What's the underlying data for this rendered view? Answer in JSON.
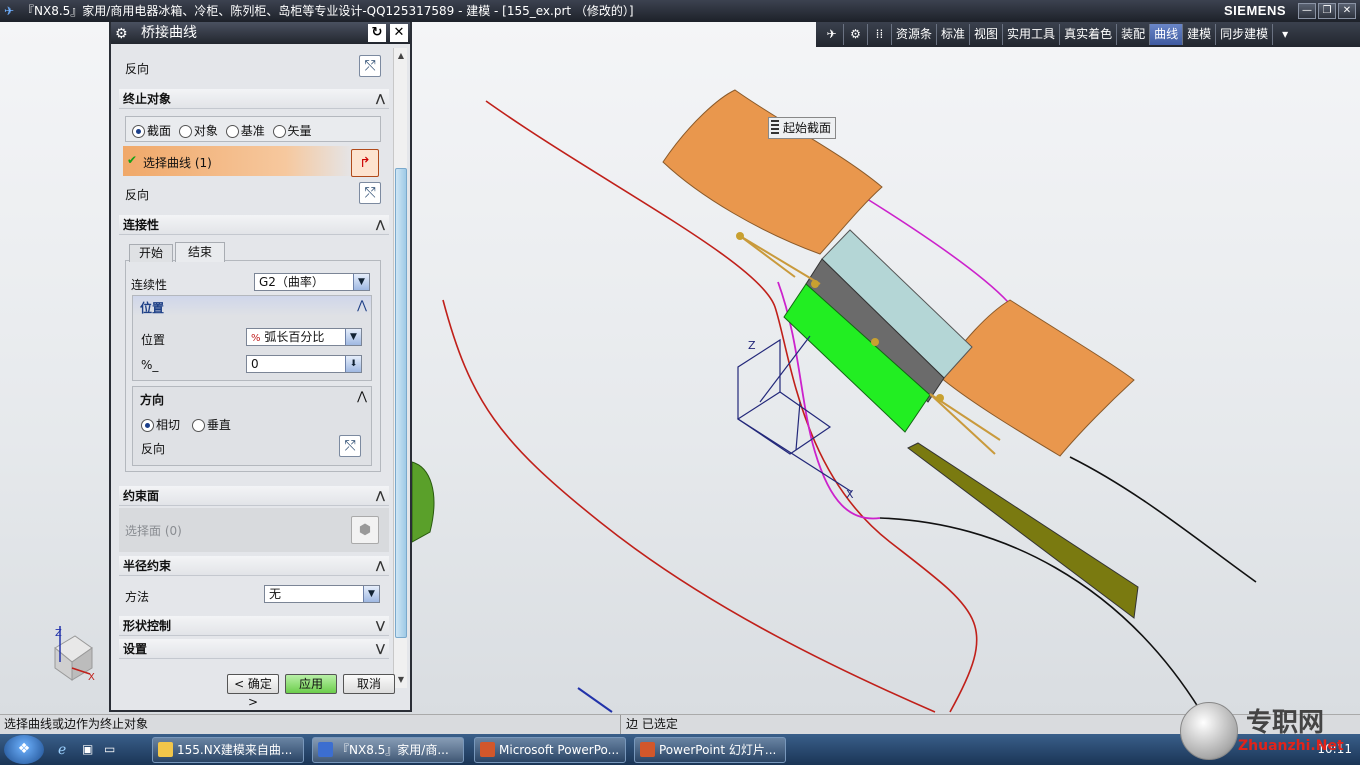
{
  "window": {
    "title": "『NX8.5』家用/商用电器冰箱、冷柜、陈列柜、岛柜等专业设计-QQ125317589 - 建模 - [155_ex.prt （修改的）]",
    "brand": "SIEMENS",
    "min": "—",
    "restore": "❐",
    "close": "✕"
  },
  "toolbar": {
    "items": [
      "资源条",
      "标准",
      "视图",
      "实用工具",
      "真实着色",
      "装配",
      "曲线",
      "建模",
      "同步建模"
    ],
    "active": "曲线"
  },
  "dialog": {
    "title": "桥接曲线",
    "reverse_top": "反向",
    "end_object": {
      "header": "终止对象",
      "options": [
        "截面",
        "对象",
        "基准",
        "矢量"
      ],
      "selected": "截面",
      "select_curve": "选择曲线 (1)",
      "reverse": "反向"
    },
    "connectivity": {
      "header": "连接性",
      "tabs": [
        "开始",
        "结束"
      ],
      "active_tab": "结束",
      "continuity_label": "连续性",
      "continuity_value": "G2（曲率）",
      "position_group": "位置",
      "position_label": "位置",
      "position_value": "弧长百分比",
      "percent_label": "%_",
      "percent_value": "0",
      "direction_group": "方向",
      "direction_options": [
        "相切",
        "垂直"
      ],
      "direction_selected": "相切",
      "direction_reverse": "反向"
    },
    "constraint_face": {
      "header": "约束面",
      "select_face": "选择面 (0)"
    },
    "radius": {
      "header": "半径约束",
      "method_label": "方法",
      "method_value": "无"
    },
    "shape_control": {
      "header": "形状控制"
    },
    "settings": {
      "header": "设置"
    },
    "buttons": {
      "ok": "< 确定 >",
      "apply": "应用",
      "cancel": "取消"
    }
  },
  "viewport": {
    "tooltip": "起始截面",
    "axis_z": "Z",
    "axis_x": "X",
    "triad_z": "Z",
    "triad_x": "X"
  },
  "statusbar": {
    "left": "选择曲线或边作为终止对象",
    "right": "边 已选定"
  },
  "taskbar": {
    "items": [
      "155.NX建模来自曲...",
      "『NX8.5』家用/商...",
      "Microsoft PowerPo...",
      "PowerPoint 幻灯片..."
    ],
    "clock": "10:11"
  },
  "watermark": {
    "cn": "专职网",
    "url": "Zhuanzhi.Net"
  },
  "colors": {
    "accent": "#f0a869",
    "active_tab": "#4e6db5",
    "green_face": "#22ee22",
    "orange_face": "#e9974d"
  }
}
